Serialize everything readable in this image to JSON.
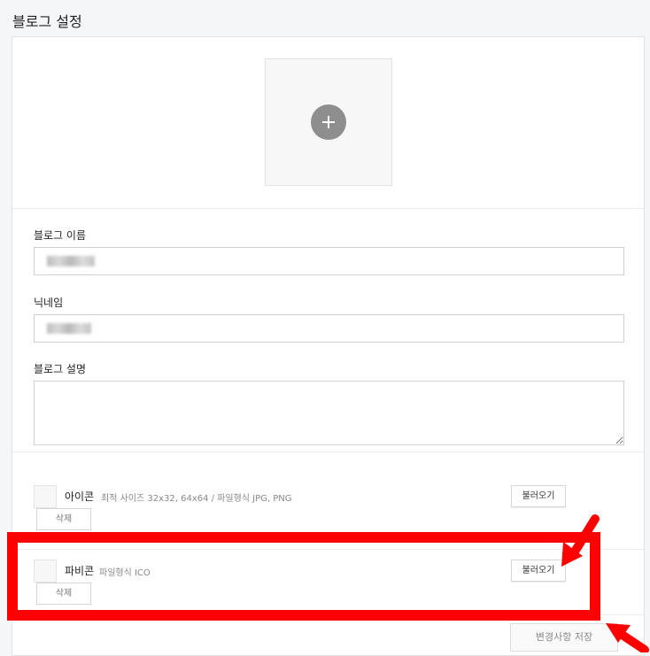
{
  "page": {
    "title": "블로그 설정"
  },
  "profile_image": {
    "icon": "plus-icon"
  },
  "fields": {
    "blog_name": {
      "label": "블로그 이름"
    },
    "nickname": {
      "label": "닉네임"
    },
    "description": {
      "label": "블로그 설명",
      "value": ""
    }
  },
  "icon_row": {
    "name": "아이콘",
    "hint": "최적 사이즈 32x32, 64x64 / 파일형식 JPG, PNG",
    "load_label": "불러오기",
    "delete_label": "삭제"
  },
  "favicon_row": {
    "name": "파비콘",
    "hint": "파일형식 ICO",
    "load_label": "불러오기",
    "delete_label": "삭제"
  },
  "footer": {
    "save_label": "변경사항 저장"
  },
  "colors": {
    "annotation": "#ff0000",
    "background": "#f5f6f8"
  }
}
